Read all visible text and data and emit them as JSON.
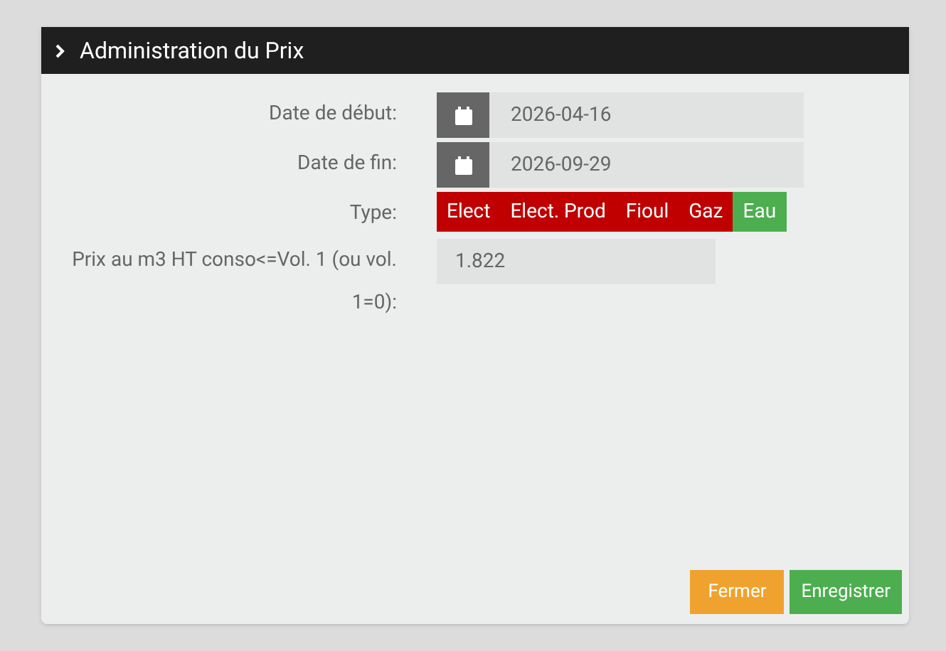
{
  "dialog": {
    "title": "Administration du Prix"
  },
  "fields": [
    {
      "kind": "date",
      "label": "Date de début:",
      "value": "2026-04-16"
    },
    {
      "kind": "date",
      "label": "Date de fin:",
      "value": "2026-09-29"
    },
    {
      "kind": "choice",
      "label": "Type:",
      "options": [
        {
          "label": "Elect",
          "selected": false
        },
        {
          "label": "Elect. Prod",
          "selected": false
        },
        {
          "label": "Fioul",
          "selected": false
        },
        {
          "label": "Gaz",
          "selected": false
        },
        {
          "label": "Eau",
          "selected": true
        }
      ]
    },
    {
      "kind": "number",
      "label": "Prix au m3 HT conso<=Vol. 1 (ou vol. 1=0):",
      "value": "1.822"
    }
  ],
  "buttons": [
    {
      "kind": "close",
      "label": "Fermer"
    },
    {
      "kind": "save",
      "label": "Enregistrer"
    }
  ]
}
